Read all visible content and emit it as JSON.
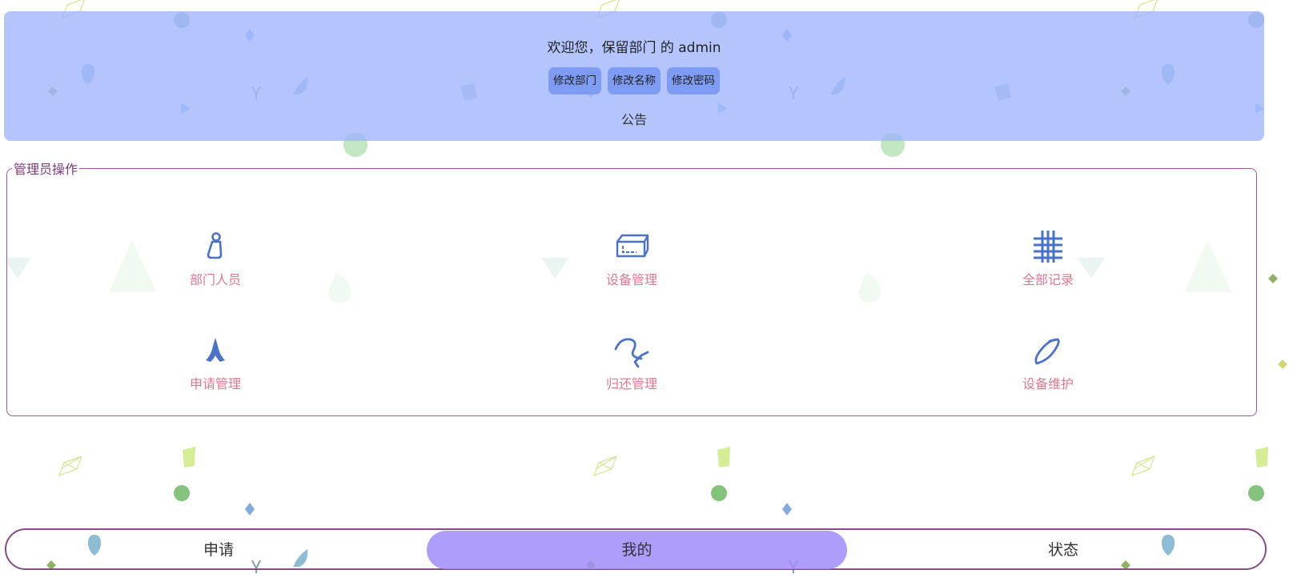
{
  "header": {
    "welcome": "欢迎您，保留部门 的 admin",
    "buttons": [
      "修改部门",
      "修改名称",
      "修改密码"
    ],
    "notice": "公告"
  },
  "admin_panel": {
    "legend": "管理员操作",
    "items": [
      {
        "label": "部门人员",
        "icon": "person-icon"
      },
      {
        "label": "设备管理",
        "icon": "box-icon"
      },
      {
        "label": "全部记录",
        "icon": "grid-icon"
      },
      {
        "label": "申请管理",
        "icon": "pray-hands-icon"
      },
      {
        "label": "归还管理",
        "icon": "return-icon"
      },
      {
        "label": "设备维护",
        "icon": "maintenance-icon"
      }
    ]
  },
  "tabbar": {
    "tabs": [
      "申请",
      "我的",
      "状态"
    ],
    "active_index": 1
  },
  "colors": {
    "header_bg": "#9bb2fd",
    "button_bg": "#7f9cf5",
    "icon": "#4a72c8",
    "label": "#e0788f",
    "border": "#9c5a9c",
    "active_tab": "#a08cfa"
  }
}
